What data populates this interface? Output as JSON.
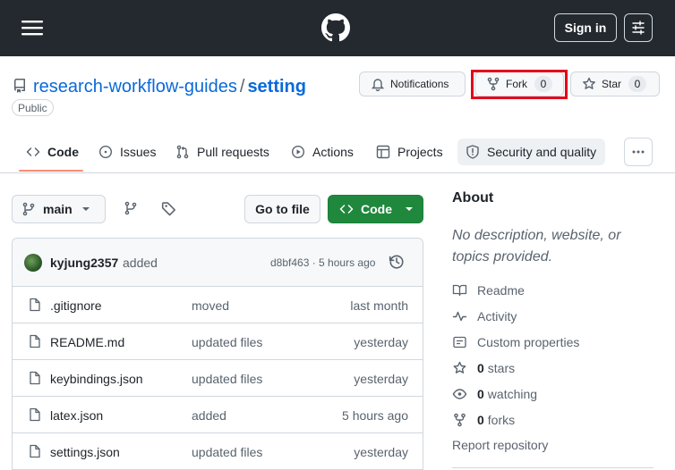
{
  "header": {
    "signin_label": "Sign in"
  },
  "repo": {
    "owner": "research-workflow-guides",
    "separator": "/",
    "name": "setting",
    "visibility": "Public",
    "notifications_label": "Notifications",
    "fork_label": "Fork",
    "fork_count": "0",
    "star_label": "Star",
    "star_count": "0"
  },
  "tabs": [
    {
      "label": "Code",
      "icon": "code-icon",
      "selected": true
    },
    {
      "label": "Issues",
      "icon": "issue-icon"
    },
    {
      "label": "Pull requests",
      "icon": "pull-request-icon"
    },
    {
      "label": "Actions",
      "icon": "play-icon"
    },
    {
      "label": "Projects",
      "icon": "table-icon"
    },
    {
      "label": "Security and quality",
      "icon": "shield-icon"
    }
  ],
  "toolbar": {
    "branch": "main",
    "go_to_file": "Go to file",
    "code_label": "Code"
  },
  "commit": {
    "author": "kyjung2357",
    "message": "added",
    "sha_time": "d8bf463 · 5 hours ago"
  },
  "files": [
    {
      "name": ".gitignore",
      "message": "moved",
      "date": "last month"
    },
    {
      "name": "README.md",
      "message": "updated files",
      "date": "yesterday"
    },
    {
      "name": "keybindings.json",
      "message": "updated files",
      "date": "yesterday"
    },
    {
      "name": "latex.json",
      "message": "added",
      "date": "5 hours ago"
    },
    {
      "name": "settings.json",
      "message": "updated files",
      "date": "yesterday"
    }
  ],
  "about": {
    "title": "About",
    "description": "No description, website, or topics provided.",
    "readme": "Readme",
    "activity": "Activity",
    "custom_properties": "Custom properties",
    "stars_count": "0",
    "stars_label": "stars",
    "watching_count": "0",
    "watching_label": "watching",
    "forks_count": "0",
    "forks_label": "forks",
    "report": "Report repository"
  },
  "colors": {
    "header_bg": "#24292f",
    "link": "#0969da",
    "primary_button": "#1f883d",
    "highlight_box": "#e3001b",
    "tab_underline": "#fd8c73"
  }
}
